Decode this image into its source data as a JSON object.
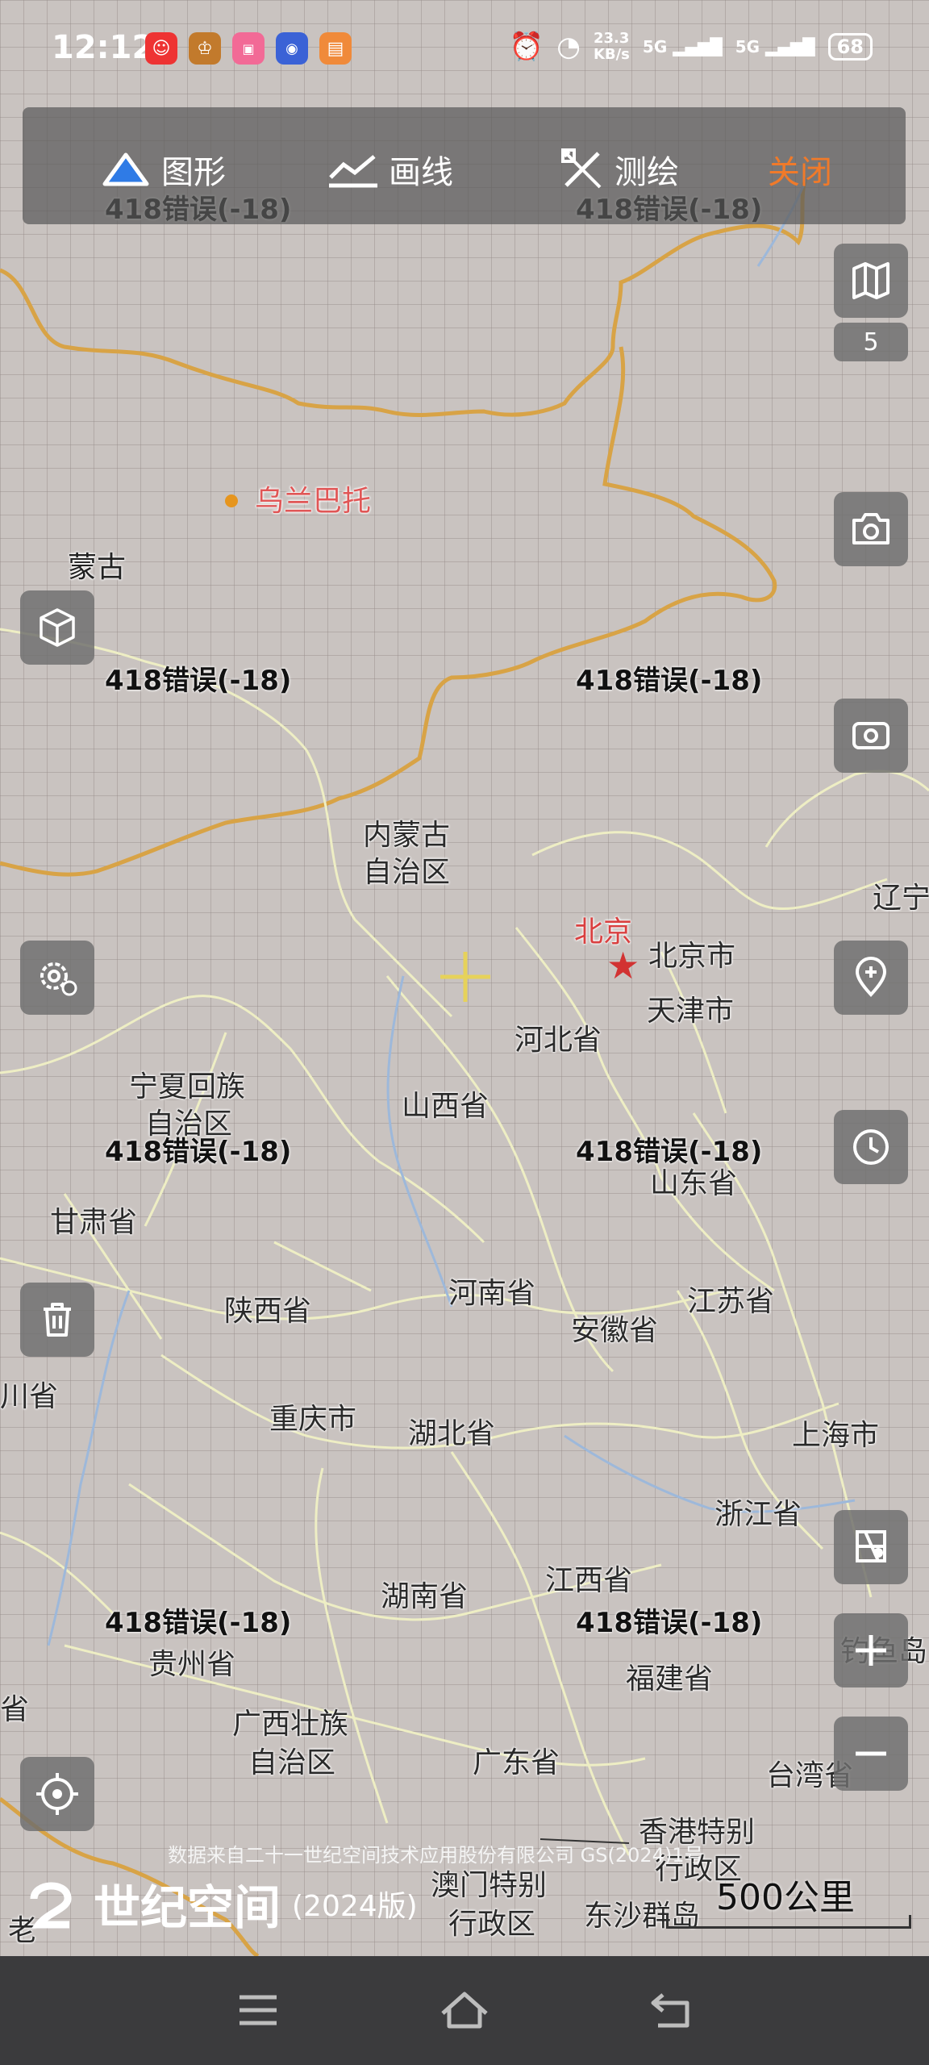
{
  "status_bar": {
    "time": "12:12",
    "net_speed_value": "23.3",
    "net_speed_unit": "KB/s",
    "signal1": "5G",
    "signal2": "5G",
    "battery": "68",
    "app_icons": [
      "clown-app-icon",
      "game-app-icon",
      "bilibili-app-icon",
      "tieba-app-icon",
      "note-app-icon"
    ]
  },
  "toolbar": {
    "shape_label": "图形",
    "line_label": "画线",
    "survey_label": "测绘",
    "close_label": "关闭",
    "close_color": "#f07a2a"
  },
  "map": {
    "labels": {
      "mongolia": "蒙古",
      "ulaanbaatar": "乌兰巴托",
      "inner_mongolia_1": "内蒙古",
      "inner_mongolia_2": "自治区",
      "beijing_capital": "北京",
      "beijing_city": "北京市",
      "tianjin": "天津市",
      "hebei": "河北省",
      "liaoning": "辽宁",
      "ningxia_1": "宁夏回族",
      "ningxia_2": "自治区",
      "shanxi": "山西省",
      "shandong": "山东省",
      "gansu": "甘肃省",
      "henan": "河南省",
      "jiangsu": "江苏省",
      "shaanxi": "陕西省",
      "anhui": "安徽省",
      "sichuan": "川省",
      "chongqing": "重庆市",
      "hubei": "湖北省",
      "shanghai": "上海市",
      "zhejiang": "浙江省",
      "hunan": "湖南省",
      "jiangxi": "江西省",
      "guizhou": "贵州省",
      "diaoyu": "钓鱼岛",
      "fujian": "福建省",
      "guangxi_1": "广西壮族",
      "guangxi_2": "自治区",
      "guangdong": "广东省",
      "taiwan": "台湾省",
      "hongkong_1": "香港特别",
      "hongkong_2": "行政区",
      "macau_1": "澳门特别",
      "macau_2": "行政区",
      "dongsha": "东沙群岛",
      "edge_sheng": "省",
      "edge_lao": "老"
    },
    "tile_error": "418错误(-18)",
    "layer_count": "5",
    "attribution": "数据来自二十一世纪空间技术应用股份有限公司 GS(2024)1号",
    "brand_name": "世纪空间",
    "brand_year": "(2024版)",
    "scale": "500公里",
    "colors": {
      "province_border": "#eeeec4",
      "country_border": "#d8a346",
      "river": "#9db8da",
      "capital": "#d23232"
    }
  },
  "side_buttons": [
    "map-layers-button",
    "camera-button",
    "screen-capture-button",
    "location-pin-button",
    "history-button",
    "3d-view-button",
    "settings-button",
    "delete-button",
    "locate-button",
    "map-overlay-button",
    "zoom-in-button",
    "zoom-out-button"
  ],
  "nav_bar": [
    "menu-icon",
    "home-icon",
    "back-icon"
  ]
}
